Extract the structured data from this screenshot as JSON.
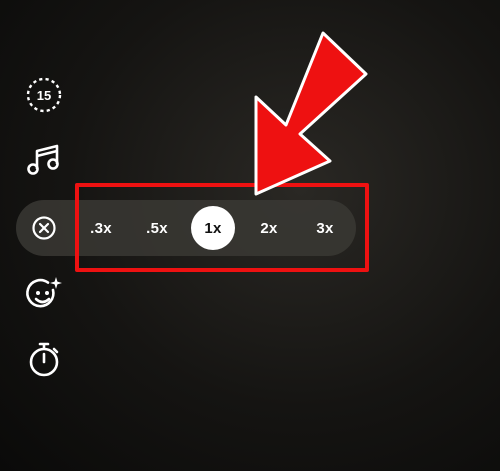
{
  "sidebar": {
    "timer_duration": "15",
    "icons": [
      "timer-15-icon",
      "music-note-icon",
      "close-circle-icon",
      "face-effects-icon",
      "stopwatch-icon"
    ]
  },
  "speed_selector": {
    "options": [
      ".3x",
      ".5x",
      "1x",
      "2x",
      "3x"
    ],
    "selected": "1x"
  },
  "annotation": {
    "highlight_color": "#ee1111",
    "arrow_color": "#ee1111"
  }
}
